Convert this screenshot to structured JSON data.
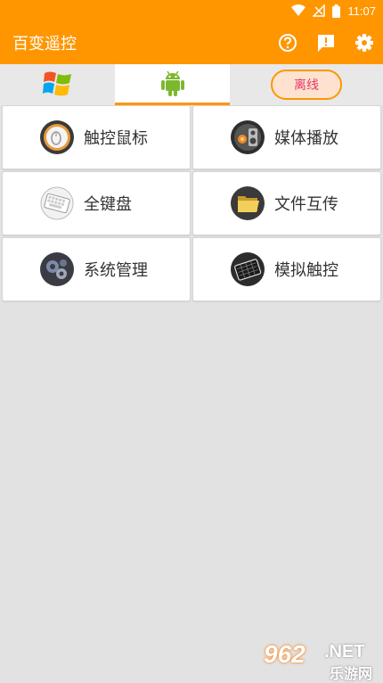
{
  "status_bar": {
    "time": "11:07",
    "icons": [
      "wifi-icon",
      "no-signal-icon",
      "battery-icon"
    ]
  },
  "app_bar": {
    "title": "百变遥控",
    "actions": [
      "help-icon",
      "feedback-icon",
      "settings-icon"
    ]
  },
  "tabs": {
    "items": [
      {
        "icon": "windows-logo-icon",
        "active": false
      },
      {
        "icon": "android-logo-icon",
        "active": true
      }
    ],
    "connection_status": "离线"
  },
  "features": [
    {
      "label": "触控鼠标",
      "icon": "mouse-icon"
    },
    {
      "label": "媒体播放",
      "icon": "media-player-icon"
    },
    {
      "label": "全键盘",
      "icon": "keyboard-icon"
    },
    {
      "label": "文件互传",
      "icon": "folder-icon"
    },
    {
      "label": "系统管理",
      "icon": "system-gears-icon"
    },
    {
      "label": "模拟触控",
      "icon": "touchpad-icon"
    }
  ],
  "watermark": {
    "number": "962",
    "domain": ".NET",
    "name": "乐游网"
  },
  "colors": {
    "accent": "#ff9600",
    "offline_text": "#e8356d",
    "background": "#e2e2e2"
  }
}
